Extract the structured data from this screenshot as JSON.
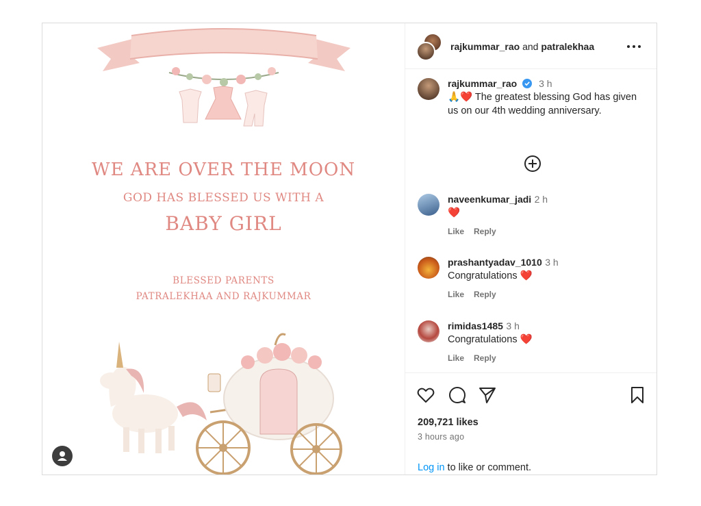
{
  "post": {
    "card": {
      "line1": "WE ARE OVER THE MOON",
      "line2": "GOD HAS BLESSED US WITH A",
      "line3": "BABY GIRL",
      "line4": "BLESSED PARENTS",
      "line5": "PATRALEKHAA AND RAJKUMMAR"
    }
  },
  "header": {
    "user1": "rajkummar_rao",
    "joiner": "and",
    "user2": "patralekhaa"
  },
  "caption": {
    "username": "rajkummar_rao",
    "time": "3 h",
    "text": "🙏❤️ The greatest blessing God has given us on our 4th wedding anniversary."
  },
  "comments": [
    {
      "username": "naveenkumar_jadi",
      "time": "2 h",
      "text": "❤️",
      "like": "Like",
      "reply": "Reply"
    },
    {
      "username": "prashantyadav_1010",
      "time": "3 h",
      "text": "Congratulations ❤️",
      "like": "Like",
      "reply": "Reply"
    },
    {
      "username": "rimidas1485",
      "time": "3 h",
      "text": "Congratulations ❤️",
      "like": "Like",
      "reply": "Reply"
    }
  ],
  "footer": {
    "likes": "209,721 likes",
    "time": "3 hours ago",
    "login_link": "Log in",
    "login_rest": " to like or comment."
  },
  "colors": {
    "accent": "#0095f6",
    "verified": "#3897f0",
    "card_text": "#e08882"
  },
  "icons": [
    "heart-icon",
    "comment-icon",
    "share-icon",
    "bookmark-icon",
    "more-icon",
    "plus-circle-icon",
    "verified-icon",
    "user-icon"
  ]
}
